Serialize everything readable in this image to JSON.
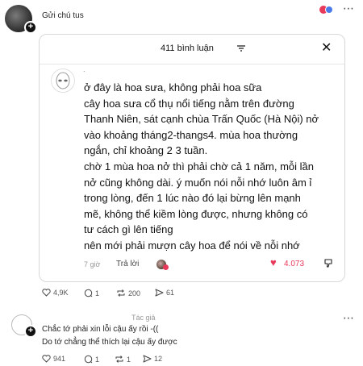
{
  "post": {
    "caption": "Gửi chú tus",
    "more_label": "⋯"
  },
  "modal": {
    "title": "411 bình luận",
    "comment": {
      "name_dot": ".",
      "lines": [
        "ở đây là hoa sưa, không phải hoa sữa",
        "cây hoa sưa cổ thụ nổi tiếng nằm trên đường",
        "Thanh Niên, sát cạnh chùa Trấn Quốc (Hà Nội) nở",
        "vào khoảng tháng2-thangs4. mùa hoa thường",
        "ngắn, chỉ khoảng 2 3 tuần.",
        "chờ 1 mùa hoa nở thì phải chờ cả 1 năm, mỗi lần",
        "nở cũng không dài. ý muốn nói nỗi nhớ luôn âm ỉ",
        "trong lòng, đến 1 lúc nào đó lại bừng lên mạnh",
        "mẽ, không thể kiềm lòng được, nhưng không có",
        "tư cách gì lên tiếng",
        "nên mới phải mượn cây hoa để nói về nỗi nhớ"
      ],
      "time": "7 giờ",
      "reply_label": "Trả lời",
      "like_count": "4.073"
    }
  },
  "post_actions": {
    "likes": "4,9K",
    "comments": "1",
    "reposts": "200",
    "shares": "61"
  },
  "reply": {
    "author_tag": "Tác giả",
    "line1": "Chắc tớ phải xin lỗi cậu ấy rồi -((",
    "line2": "Do tớ chẳng thể thích lại cậu ấy được",
    "more_label": "⋯",
    "actions": {
      "likes": "941",
      "comments": "1",
      "reposts": "1",
      "shares": "12"
    }
  },
  "colors": {
    "accent_like": "#e8395a"
  }
}
